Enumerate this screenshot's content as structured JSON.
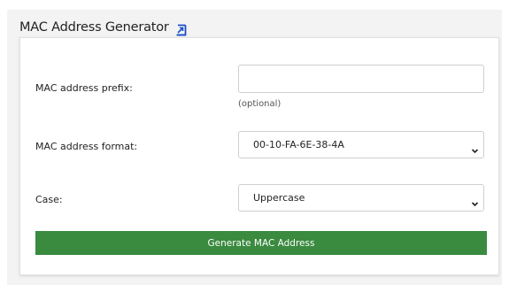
{
  "header": {
    "title": "MAC Address Generator",
    "popout_icon": "external-link-icon"
  },
  "form": {
    "prefix": {
      "label": "MAC address prefix:",
      "value": "",
      "placeholder": "",
      "hint": "(optional)"
    },
    "format": {
      "label": "MAC address format:",
      "selected": "00-10-FA-6E-38-4A"
    },
    "case": {
      "label": "Case:",
      "selected": "Uppercase"
    },
    "generate_label": "Generate MAC Address"
  },
  "colors": {
    "button": "#3a8a3f",
    "background": "#f3f3f3",
    "icon": "#1a4fc7"
  }
}
